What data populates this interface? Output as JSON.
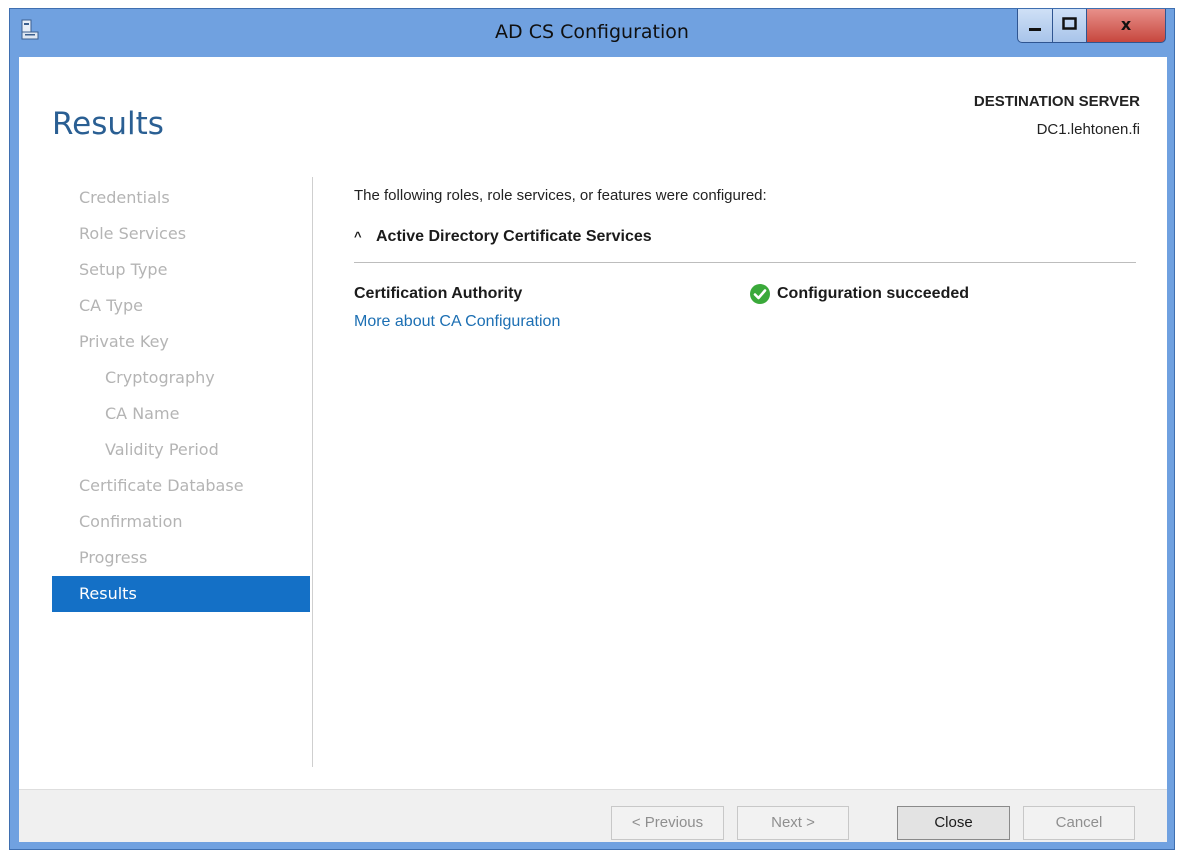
{
  "window": {
    "title": "AD CS Configuration",
    "controls": {
      "minimize": "–",
      "maximize": "□",
      "close": "x"
    }
  },
  "header": {
    "page_title": "Results",
    "destination_label": "DESTINATION SERVER",
    "destination_server": "DC1.lehtonen.fi"
  },
  "nav": {
    "items": [
      {
        "label": "Credentials"
      },
      {
        "label": "Role Services"
      },
      {
        "label": "Setup Type"
      },
      {
        "label": "CA Type"
      },
      {
        "label": "Private Key"
      },
      {
        "label": "Cryptography"
      },
      {
        "label": "CA Name"
      },
      {
        "label": "Validity Period"
      },
      {
        "label": "Certificate Database"
      },
      {
        "label": "Confirmation"
      },
      {
        "label": "Progress"
      },
      {
        "label": "Results"
      }
    ],
    "active": "Results"
  },
  "content": {
    "intro": "The following roles, role services, or features were configured:",
    "section_title": "Active Directory Certificate Services",
    "section_caret": "^",
    "row_name": "Certification Authority",
    "row_link": "More about CA Configuration",
    "row_status": "Configuration succeeded",
    "status_icon": "check-circle-icon",
    "status_color": "#3aa93a"
  },
  "buttons": {
    "previous": "< Previous",
    "next": "Next >",
    "close": "Close",
    "cancel": "Cancel"
  },
  "colors": {
    "frame": "#70a1e0",
    "accent": "#1470c6",
    "title_text": "#2a5f93",
    "link": "#1c6fb3"
  }
}
